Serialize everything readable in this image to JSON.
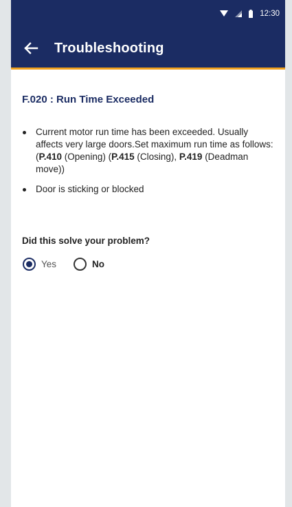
{
  "status_bar": {
    "time": "12:30",
    "icons": [
      "wifi-icon",
      "signal-icon",
      "battery-icon"
    ]
  },
  "app_bar": {
    "title": "Troubleshooting",
    "back_icon": "back-arrow-icon"
  },
  "fault": {
    "title": "F.020 : Run Time Exceeded",
    "causes": {
      "c1": {
        "text_a": "Current motor run time has been exceeded. Usually affects very large doors.Set maximum run time as follows: (",
        "p1": "P.410",
        "text_b": " (Opening) (",
        "p2": "P.415",
        "text_c": " (Closing), ",
        "p3": "P.419",
        "text_d": " (Deadman move))"
      },
      "c2": {
        "text": "Door is sticking or blocked"
      }
    }
  },
  "feedback": {
    "question": "Did this solve your problem?",
    "options": [
      {
        "label": "Yes",
        "selected": true
      },
      {
        "label": "No",
        "selected": false
      }
    ]
  },
  "colors": {
    "header": "#1b2c63",
    "accent": "#f0a11e",
    "background": "#e2e6e8"
  }
}
